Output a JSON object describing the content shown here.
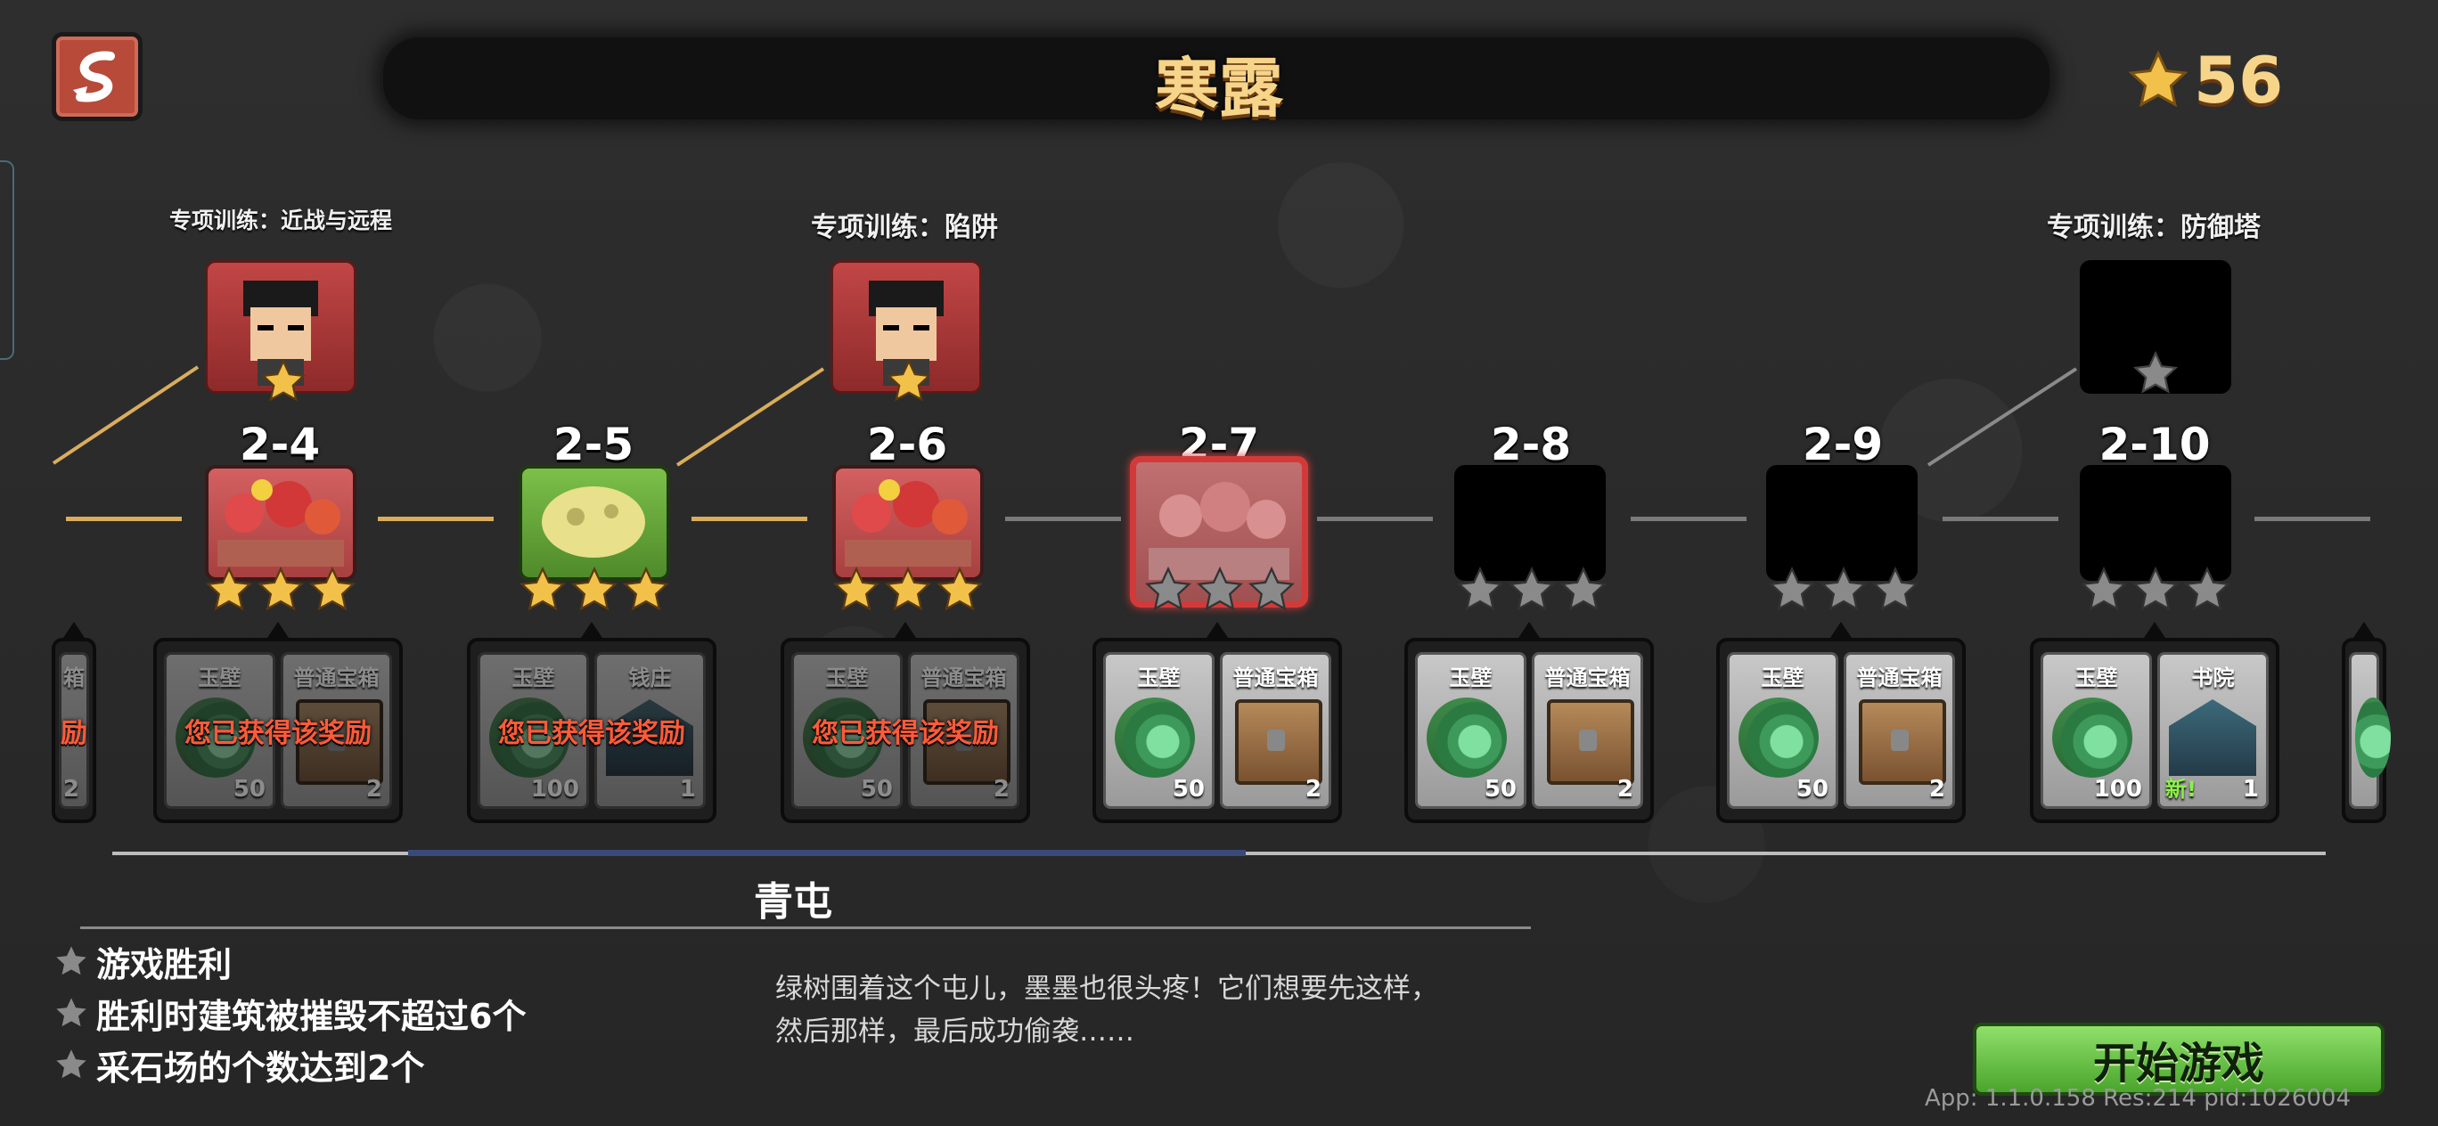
{
  "title": "寒露",
  "star_total": "56",
  "trainings": {
    "t1": "专项训练：近战与远程",
    "t2": "专项训练：陷阱",
    "t3": "专项训练：防御塔"
  },
  "levels": [
    {
      "id": "2-4",
      "state": "cleared",
      "stars": 3
    },
    {
      "id": "2-5",
      "state": "cleared",
      "stars": 3
    },
    {
      "id": "2-6",
      "state": "cleared",
      "stars": 3
    },
    {
      "id": "2-7",
      "state": "selected",
      "stars": 0
    },
    {
      "id": "2-8",
      "state": "locked",
      "stars": 0
    },
    {
      "id": "2-9",
      "state": "locked",
      "stars": 0
    },
    {
      "id": "2-10",
      "state": "locked",
      "stars": 0
    }
  ],
  "partial_left": {
    "label": "箱",
    "qty": "2",
    "msg": "励"
  },
  "rewards": [
    {
      "a": "玉壁",
      "a_qty": "50",
      "b": "普通宝箱",
      "b_qty": "2",
      "claimed": "您已获得该奖励"
    },
    {
      "a": "玉壁",
      "a_qty": "100",
      "b": "钱庄",
      "b_qty": "1",
      "claimed": "您已获得该奖励"
    },
    {
      "a": "玉壁",
      "a_qty": "50",
      "b": "普通宝箱",
      "b_qty": "2",
      "claimed": "您已获得该奖励"
    },
    {
      "a": "玉壁",
      "a_qty": "50",
      "b": "普通宝箱",
      "b_qty": "2"
    },
    {
      "a": "玉壁",
      "a_qty": "50",
      "b": "普通宝箱",
      "b_qty": "2"
    },
    {
      "a": "玉壁",
      "a_qty": "50",
      "b": "普通宝箱",
      "b_qty": "2"
    },
    {
      "a": "玉壁",
      "a_qty": "100",
      "b": "书院",
      "b_qty": "1",
      "new": "新!"
    }
  ],
  "section": "青屯",
  "objectives": [
    "游戏胜利",
    "胜利时建筑被摧毁不超过6个",
    "采石场的个数达到2个"
  ],
  "description": {
    "line1": "绿树围着这个屯儿，墨墨也很头疼！它们想要先这样，",
    "line2": "然后那样，最后成功偷袭……"
  },
  "start_button": "开始游戏",
  "app_info": "App: 1.1.0.158 Res:214 pid:1026004",
  "colors": {
    "gold_star": "#f2c14a",
    "gray_star": "#8a8a8a",
    "accent_red": "#d23a3a",
    "start_green": "#6cc44a"
  }
}
